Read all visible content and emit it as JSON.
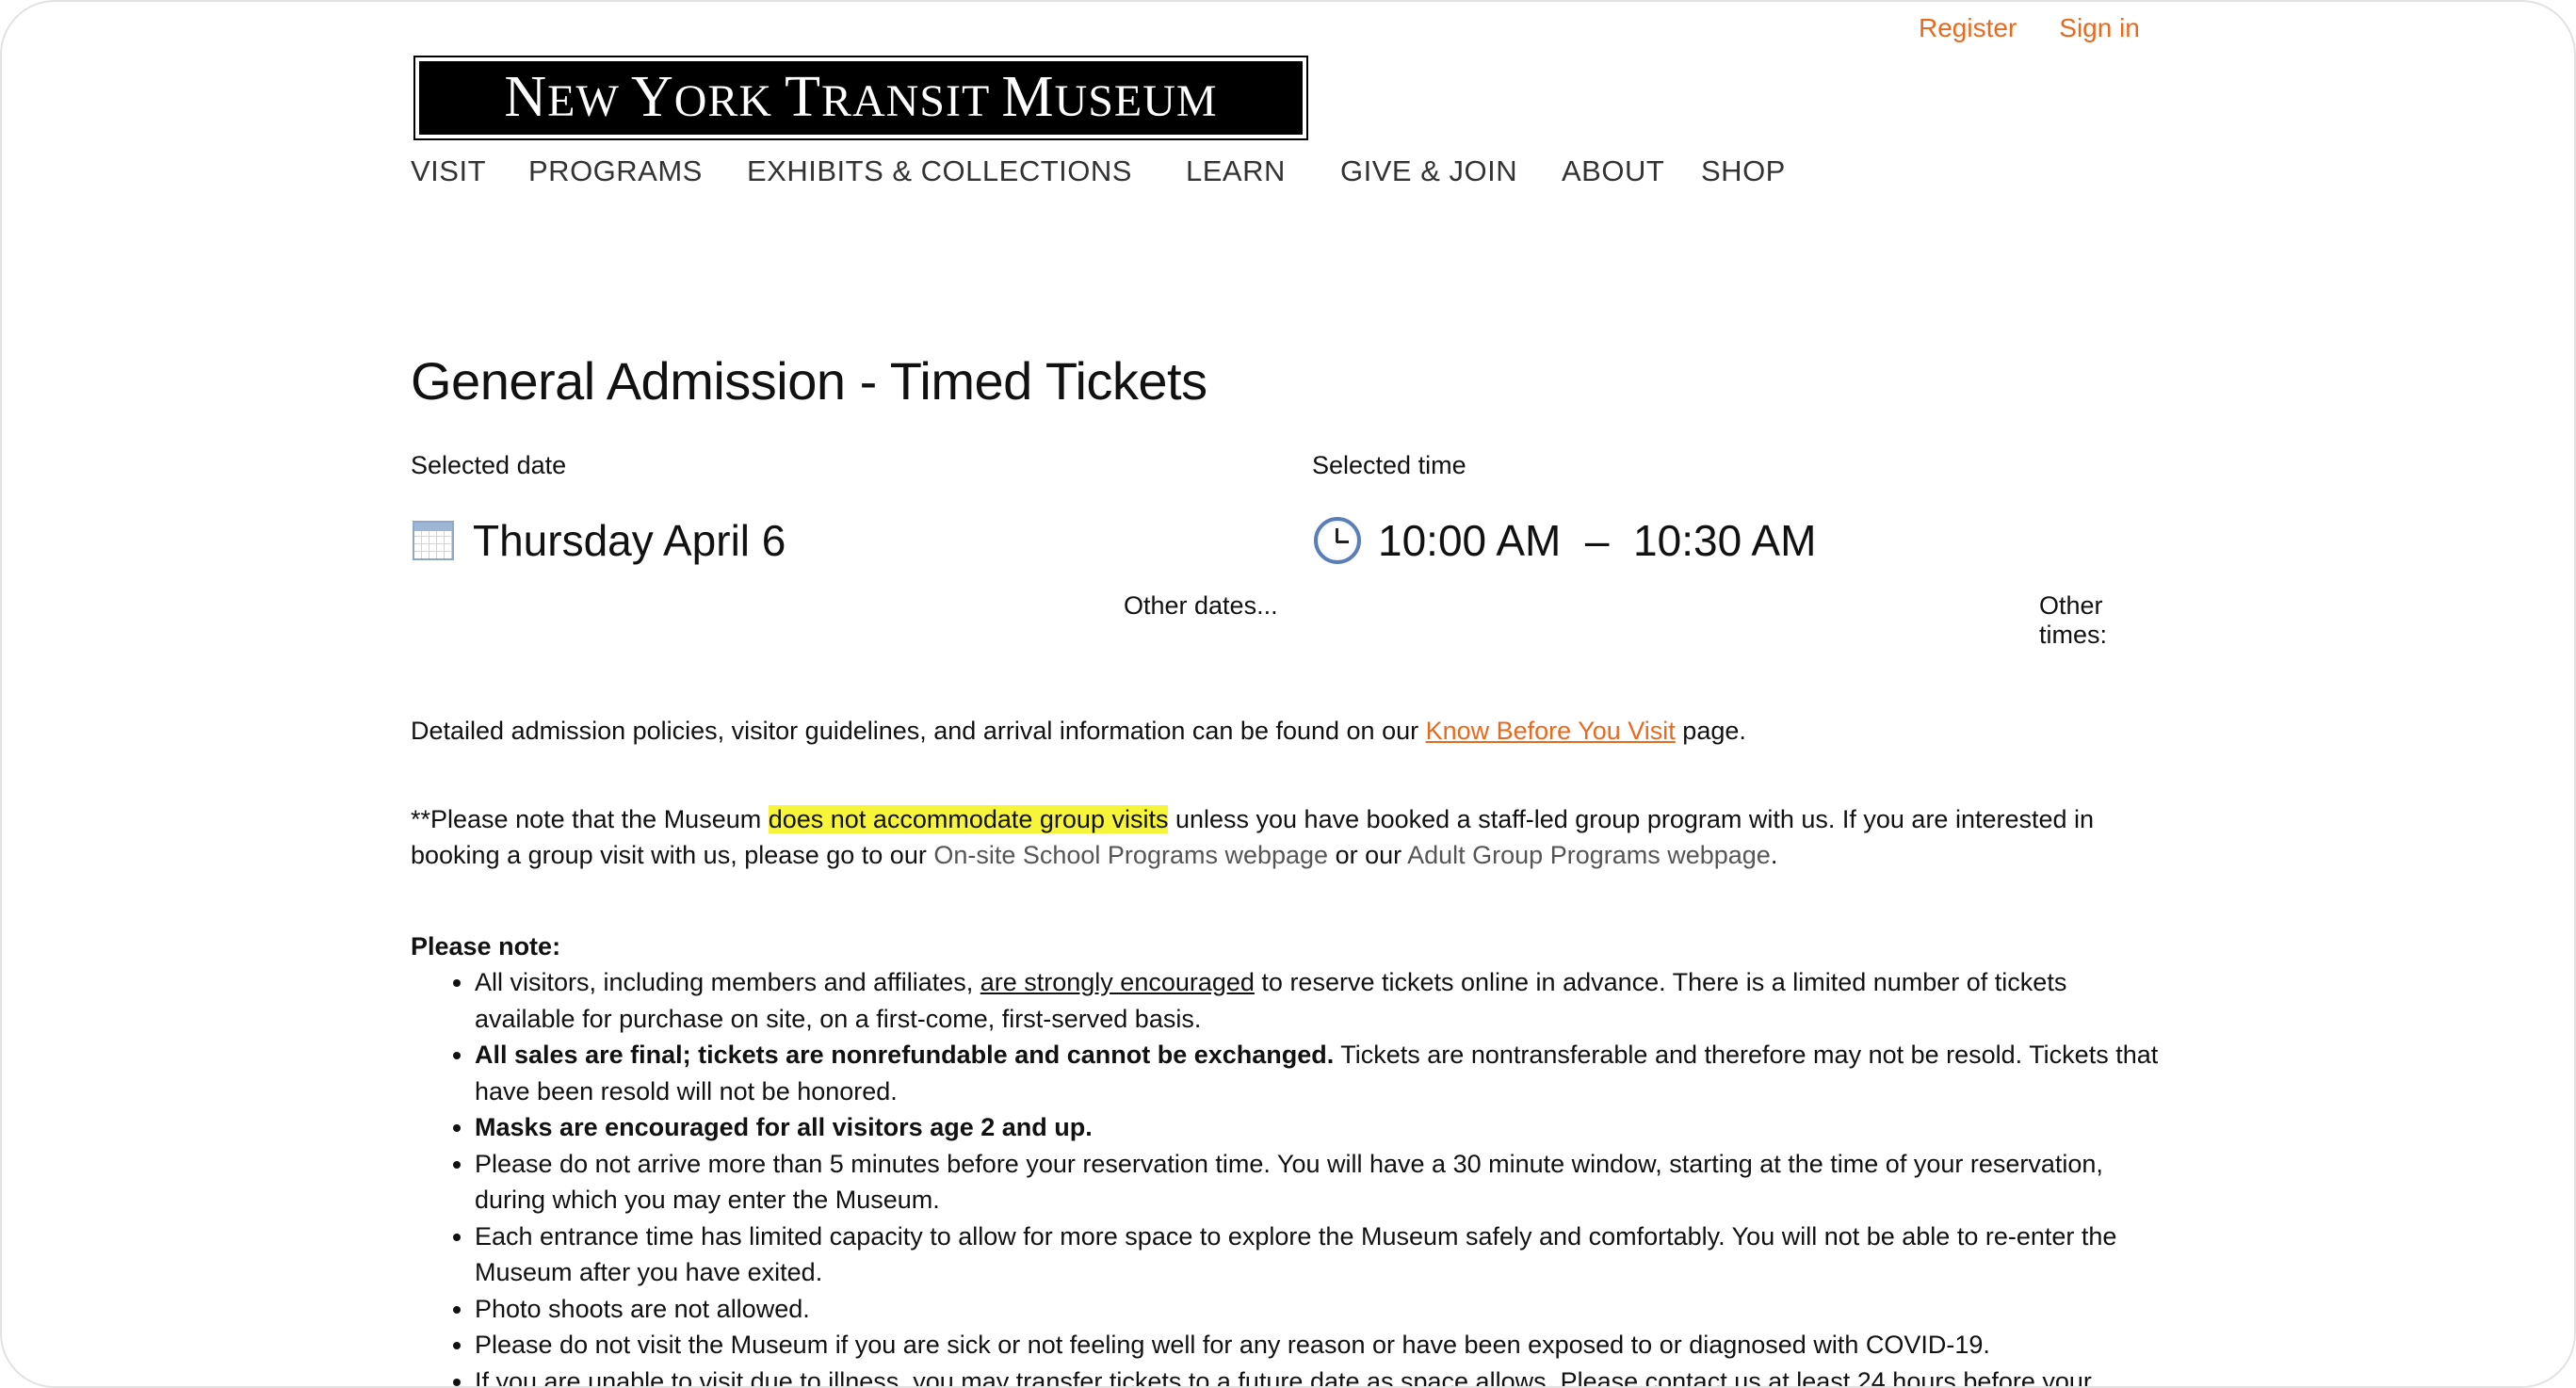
{
  "header": {
    "register": "Register",
    "sign_in": "Sign in",
    "logo_text": "New York Transit Museum"
  },
  "nav": {
    "items": [
      "VISIT",
      "PROGRAMS",
      "EXHIBITS & COLLECTIONS",
      "LEARN",
      "GIVE & JOIN",
      "ABOUT",
      "SHOP"
    ]
  },
  "page": {
    "title": "General Admission - Timed Tickets",
    "selected_date_label": "Selected date",
    "selected_date": "Thursday April 6",
    "other_dates": "Other dates...",
    "selected_time_label": "Selected time",
    "selected_time": "10:00 AM  –  10:30 AM",
    "other_times": "Other times:"
  },
  "info": {
    "p1_before": "Detailed admission policies, visitor guidelines, and arrival information can be found on our ",
    "p1_link": "Know Before You Visit",
    "p1_after": " page.",
    "p2_before": "**Please note that the Museum ",
    "p2_highlight": "does not accommodate group visits",
    "p2_mid": " unless you have booked a staff-led group program with us. If you are interested in booking a group visit with us, please go to our ",
    "p2_link1": "On-site School Programs webpage",
    "p2_or": " or our ",
    "p2_link2": "Adult Group Programs webpage",
    "p2_end": "."
  },
  "notes": {
    "heading": "Please note:",
    "n1_before": "All visitors, including members and affiliates, ",
    "n1_underline": "are strongly encouraged",
    "n1_after": " to reserve tickets online in advance. There is a limited number of tickets available for purchase on site, on a first-come, first-served basis.",
    "n2_bold": "All sales are final; tickets are nonrefundable and cannot be exchanged.",
    "n2_after": " Tickets are nontransferable and therefore may not be resold. Tickets that have been resold will not be honored.",
    "n3_bold": "Masks are encouraged for all visitors age 2 and up.",
    "n4": "Please do not arrive more than 5 minutes before your reservation time. You will have a 30 minute window, starting at the time of your reservation, during which you may enter the Museum.",
    "n5": "Each entrance time has limited capacity to allow for more space to explore the Museum safely and comfortably. You will not be able to re-enter the Museum after you have exited.",
    "n6": "Photo shoots are not allowed.",
    "n7": "Please do not visit the Museum if you are sick or not feeling well for any reason or have been exposed to or diagnosed with COVID-19.",
    "n8": "If you are unable to visit due to illness, you may transfer tickets to a future date as space allows. Please contact us at least 24 hours before your"
  }
}
